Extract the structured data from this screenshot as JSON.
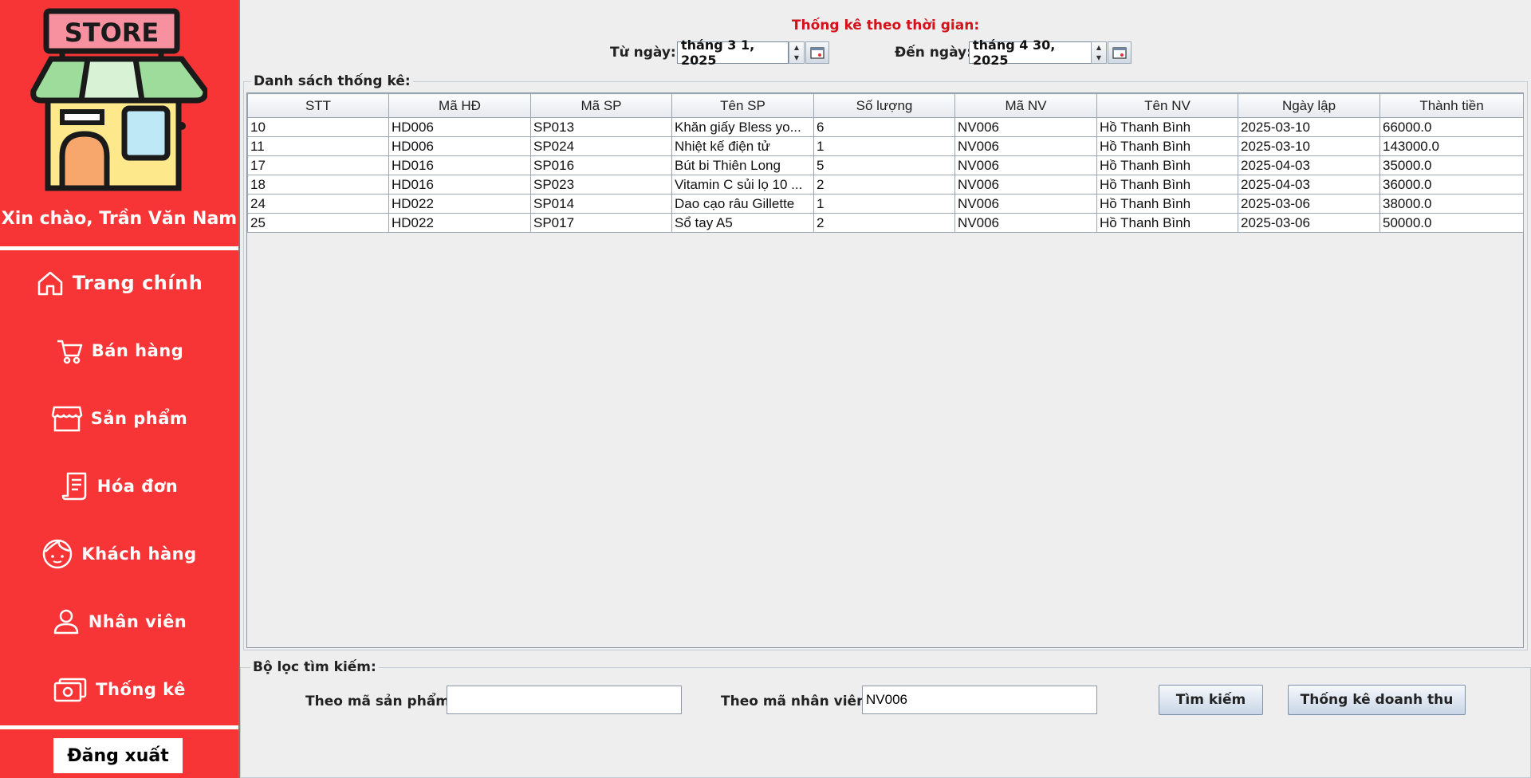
{
  "sidebar": {
    "logo_text": "STORE",
    "greeting": "Xin chào, Trần Văn Nam",
    "items": [
      {
        "label": "Trang chính",
        "icon": "home-icon"
      },
      {
        "label": "Bán hàng",
        "icon": "cart-icon"
      },
      {
        "label": "Sản phẩm",
        "icon": "store-icon"
      },
      {
        "label": "Hóa đơn",
        "icon": "receipt-icon"
      },
      {
        "label": "Khách hàng",
        "icon": "face-icon"
      },
      {
        "label": "Nhân viên",
        "icon": "user-icon"
      },
      {
        "label": "Thống kê",
        "icon": "money-icon"
      }
    ],
    "logout": "Đăng xuất"
  },
  "header": {
    "title": "Thống kê theo thời gian:",
    "from_label": "Từ ngày:",
    "from_value": "tháng 3 1, 2025",
    "to_label": "Đến ngày:",
    "to_value": "tháng 4 30, 2025"
  },
  "list_title": "Danh sách thống kê:",
  "table": {
    "columns": [
      "STT",
      "Mã HĐ",
      "Mã SP",
      "Tên SP",
      "Số lượng",
      "Mã NV",
      "Tên NV",
      "Ngày lập",
      "Thành tiền"
    ],
    "rows": [
      [
        "10",
        "HD006",
        "SP013",
        "Khăn giấy Bless yo...",
        "6",
        "NV006",
        "Hồ Thanh Bình",
        "2025-03-10",
        "66000.0"
      ],
      [
        "11",
        "HD006",
        "SP024",
        "Nhiệt kế điện tử",
        "1",
        "NV006",
        "Hồ Thanh Bình",
        "2025-03-10",
        "143000.0"
      ],
      [
        "17",
        "HD016",
        "SP016",
        "Bút bi Thiên Long",
        "5",
        "NV006",
        "Hồ Thanh Bình",
        "2025-04-03",
        "35000.0"
      ],
      [
        "18",
        "HD016",
        "SP023",
        "Vitamin C sủi lọ 10 ...",
        "2",
        "NV006",
        "Hồ Thanh Bình",
        "2025-04-03",
        "36000.0"
      ],
      [
        "24",
        "HD022",
        "SP014",
        "Dao cạo râu Gillette",
        "1",
        "NV006",
        "Hồ Thanh Bình",
        "2025-03-06",
        "38000.0"
      ],
      [
        "25",
        "HD022",
        "SP017",
        "Sổ tay A5",
        "2",
        "NV006",
        "Hồ Thanh Bình",
        "2025-03-06",
        "50000.0"
      ]
    ]
  },
  "filter": {
    "title": "Bộ lọc tìm kiếm:",
    "product_label": "Theo mã sản phẩm:",
    "product_value": "",
    "employee_label": "Theo mã nhân viên:",
    "employee_value": "NV006",
    "search_button": "Tìm kiếm",
    "revenue_button": "Thống kê doanh thu"
  },
  "colors": {
    "sidebar": "#f83536",
    "title": "#d4121b"
  }
}
